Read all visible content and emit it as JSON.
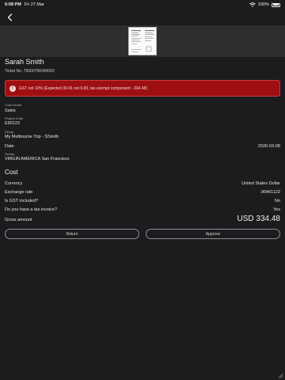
{
  "status_bar": {
    "time": "6:08 PM",
    "date": "Fri 27 Mar",
    "battery": "100%",
    "battery_level": 1.0
  },
  "nav": {
    "back_icon": "chevron-left-icon"
  },
  "receipt": {
    "thumbnail_icon": "receipt-thumbnail"
  },
  "header": {
    "name": "Sarah Smith",
    "ticket": "Ticket No. 75600796040000"
  },
  "warning": {
    "icon": "alert-circle-icon",
    "text": "GST not 10% (Expected 30.41 not 0.00, tax exempt component: -334.48)",
    "color": "#9e0f12"
  },
  "fields": {
    "cost_centre_label": "Cost Centre",
    "cost_centre_value": "Sales",
    "project_code_label": "Project Code",
    "project_code_value": "E90123",
    "group_label": "Group",
    "group_value": "My Melbourne Trip - SSmith",
    "date_label": "Date",
    "date_value": "2026-03-08",
    "vendor_label": "Vendor",
    "vendor_value": "VIRGIN AMERICA San Francisco"
  },
  "cost": {
    "title": "Cost",
    "currency_label": "Currency",
    "currency_value": "United States Dollar",
    "exchange_label": "Exchange rate",
    "exchange_value": ".90461122",
    "gst_label": "Is GST included?",
    "gst_value": "No",
    "tax_invoice_label": "Do you have a tax invoice?",
    "tax_invoice_value": "Yes",
    "gross_label": "Gross amount",
    "gross_value": "USD 334.48"
  },
  "actions": {
    "return_label": "Return",
    "approve_label": "Approve"
  }
}
